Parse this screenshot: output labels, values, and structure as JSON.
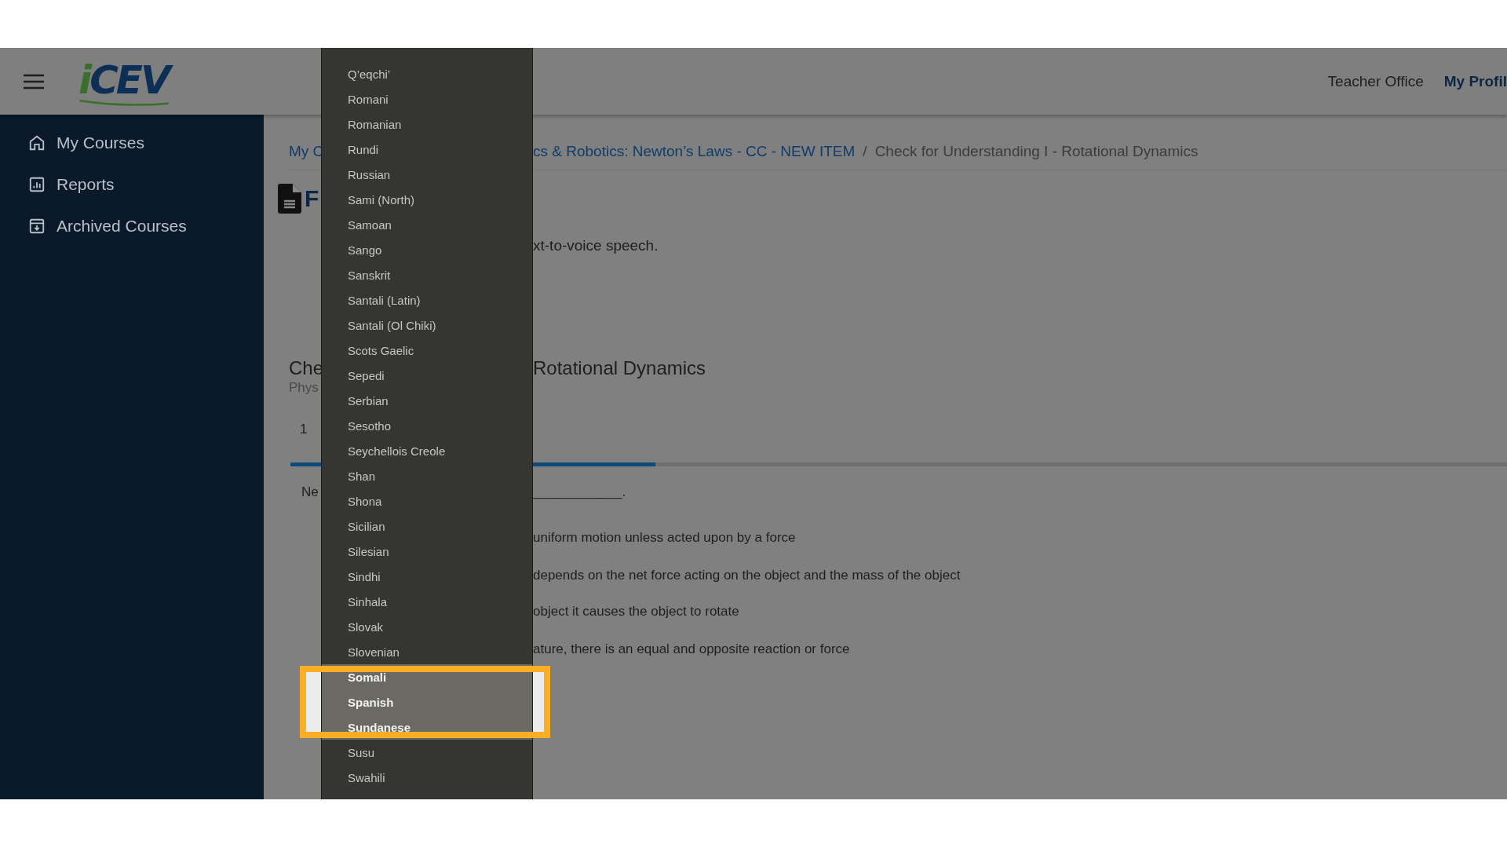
{
  "header": {
    "logo": {
      "accent": "i",
      "text": "CEV"
    },
    "links": [
      {
        "label": "Teacher Office",
        "kind": "plain"
      },
      {
        "label": "My Profil",
        "kind": "strong"
      }
    ]
  },
  "sidebar": {
    "items": [
      {
        "label": "My Courses"
      },
      {
        "label": "Reports"
      },
      {
        "label": "Archived Courses"
      }
    ]
  },
  "breadcrumb": {
    "left": "My C",
    "right": [
      {
        "label": "cs & Robotics: Newton’s Laws - CC - NEW ITEM",
        "kind": "link"
      },
      {
        "label": "/",
        "kind": "separator"
      },
      {
        "label": "Check for Understanding I - Rotational Dynamics",
        "kind": "current"
      }
    ]
  },
  "page_title": "F",
  "notice": "xt-to-voice speech.",
  "quiz": {
    "title_left": "Che",
    "title_right": "Rotational Dynamics",
    "subtitle": "Phys",
    "counter": "1",
    "progress": {
      "level": 0.3
    },
    "question_left": "Ne",
    "question_right": "____________.",
    "options": [
      "uniform motion unless acted upon by a force",
      "depends on the net force acting on the object and the mass of the object",
      "object it causes the object to rotate",
      "ature, there is an equal and opposite reaction or force"
    ]
  },
  "language_menu": {
    "items": [
      {
        "label": "Q’eqchi’",
        "highlighted": false
      },
      {
        "label": "Romani",
        "highlighted": false
      },
      {
        "label": "Romanian",
        "highlighted": false
      },
      {
        "label": "Rundi",
        "highlighted": false
      },
      {
        "label": "Russian",
        "highlighted": false
      },
      {
        "label": "Sami (North)",
        "highlighted": false
      },
      {
        "label": "Samoan",
        "highlighted": false
      },
      {
        "label": "Sango",
        "highlighted": false
      },
      {
        "label": "Sanskrit",
        "highlighted": false
      },
      {
        "label": "Santali (Latin)",
        "highlighted": false
      },
      {
        "label": "Santali (Ol Chiki)",
        "highlighted": false
      },
      {
        "label": "Scots Gaelic",
        "highlighted": false
      },
      {
        "label": "Sepedi",
        "highlighted": false
      },
      {
        "label": "Serbian",
        "highlighted": false
      },
      {
        "label": "Sesotho",
        "highlighted": false
      },
      {
        "label": "Seychellois Creole",
        "highlighted": false
      },
      {
        "label": "Shan",
        "highlighted": false
      },
      {
        "label": "Shona",
        "highlighted": false
      },
      {
        "label": "Sicilian",
        "highlighted": false
      },
      {
        "label": "Silesian",
        "highlighted": false
      },
      {
        "label": "Sindhi",
        "highlighted": false
      },
      {
        "label": "Sinhala",
        "highlighted": false
      },
      {
        "label": "Slovak",
        "highlighted": false
      },
      {
        "label": "Slovenian",
        "highlighted": false
      },
      {
        "label": "Somali",
        "highlighted": true
      },
      {
        "label": "Spanish",
        "highlighted": true
      },
      {
        "label": "Sundanese",
        "highlighted": true
      },
      {
        "label": "Susu",
        "highlighted": false
      },
      {
        "label": "Swahili",
        "highlighted": false
      }
    ]
  }
}
